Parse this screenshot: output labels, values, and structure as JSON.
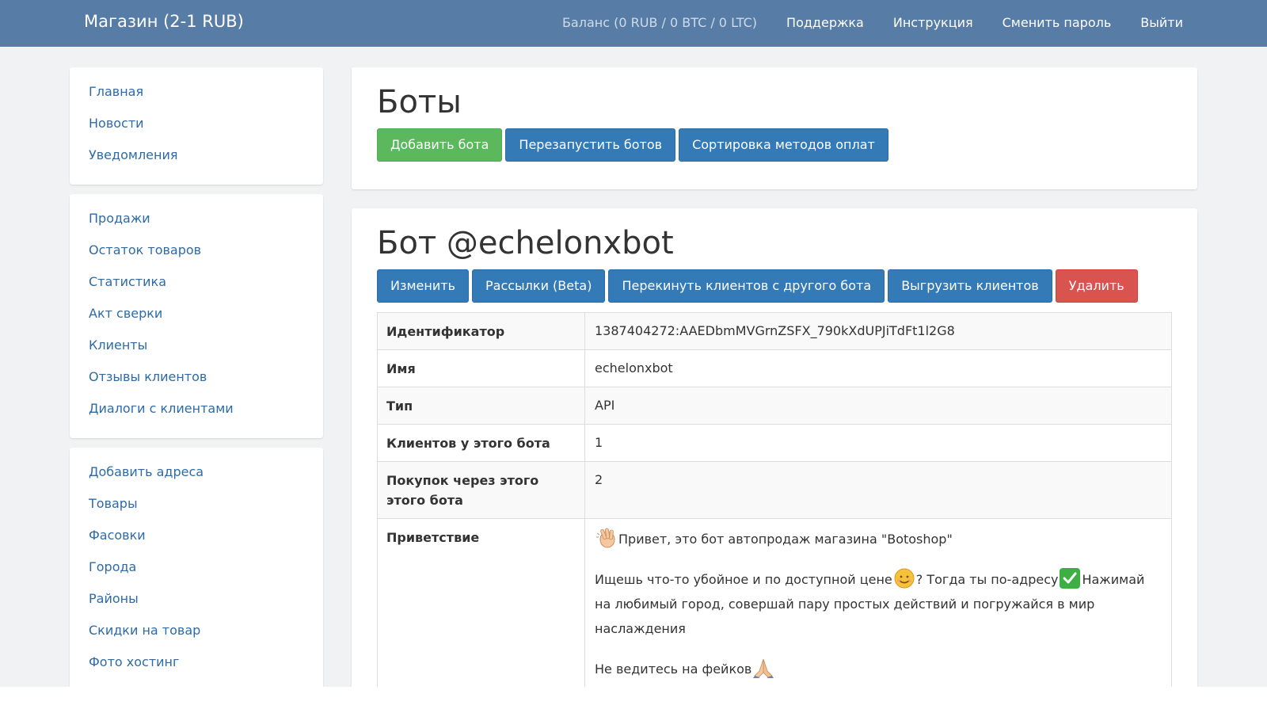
{
  "navbar": {
    "brand": "Магазин (2-1 RUB)",
    "balance": "Баланс (0 RUB / 0 BTC / 0 LTC)",
    "links": [
      "Поддержка",
      "Инструкция",
      "Сменить пароль",
      "Выйти"
    ]
  },
  "sidebar": {
    "group1": [
      "Главная",
      "Новости",
      "Уведомления"
    ],
    "group2": [
      "Продажи",
      "Остаток товаров",
      "Статистика",
      "Акт сверки",
      "Клиенты",
      "Отзывы клиентов",
      "Диалоги с клиентами"
    ],
    "group3": [
      "Добавить адреса",
      "Товары",
      "Фасовки",
      "Города",
      "Районы",
      "Скидки на товар",
      "Фото хостинг"
    ]
  },
  "header": {
    "title": "Боты",
    "buttons": [
      "Добавить бота",
      "Перезапустить ботов",
      "Сортировка методов оплат"
    ]
  },
  "bot": {
    "title": "Бот @echelonxbot",
    "buttons": [
      "Изменить",
      "Рассылки (Beta)",
      "Перекинуть клиентов с другого бота",
      "Выгрузить клиентов",
      "Удалить"
    ],
    "rows": [
      {
        "label": "Идентификатор",
        "value": "1387404272:AAEDbmMVGrnZSFX_790kXdUPJiTdFt1l2G8"
      },
      {
        "label": "Имя",
        "value": "echelonxbot"
      },
      {
        "label": "Тип",
        "value": "API"
      },
      {
        "label": "Клиентов у этого бота",
        "value": "1"
      },
      {
        "label": "Покупок через этого этого бота",
        "value": "2"
      }
    ],
    "greeting_label": "Приветствие",
    "greeting": {
      "line1": "Привет, это бот автопродаж магазина \"Botoshop\"",
      "line2a": "Ищешь что-то убойное и по доступной цене",
      "line2b": "? Тогда ты по-адресу",
      "line2c": "Нажимай на любимый город, совершай пару простых действий и погружайся в мир наслаждения",
      "line3": "Не ведитесь на фейков"
    }
  },
  "icons": {
    "wave": "waving-hand-icon",
    "smile": "smiling-face-icon",
    "check": "check-mark-button-icon",
    "pray": "folded-hands-icon"
  },
  "colors": {
    "navbar": "#577ca5",
    "link": "#2e6ba6",
    "success": "#5cb85c",
    "primary": "#337ab7",
    "danger": "#d9534f",
    "background": "#f1f2f4"
  }
}
